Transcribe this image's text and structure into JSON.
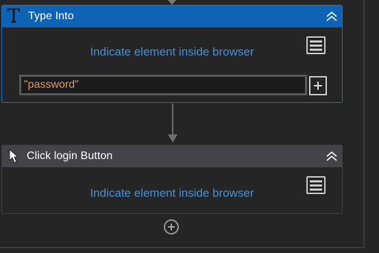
{
  "activities": [
    {
      "title": "Type Into",
      "icon": "type-into-T-icon",
      "indicate_link": "Indicate element inside browser",
      "input_value": "\"password\"",
      "selected": true,
      "accent_color": "#0e63b4"
    },
    {
      "title": "Click login Button",
      "icon": "cursor-arrow-icon",
      "indicate_link": "Indicate element inside browser",
      "selected": false,
      "accent_color": "#444448"
    }
  ],
  "icons": {
    "type_into_glyph": "T",
    "collapse": "double-chevron-up-icon",
    "menu": "hamburger-menu-icon",
    "plus": "plus-icon",
    "add_activity": "add-circle-icon"
  },
  "colors": {
    "background": "#252526",
    "link": "#4a8fd3",
    "input_text": "#d99a6c",
    "selected_border": "#1673c7"
  }
}
